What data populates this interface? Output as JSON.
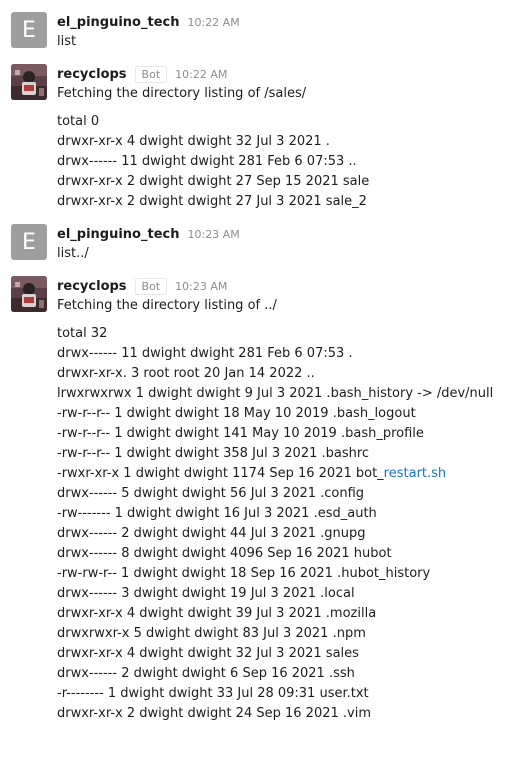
{
  "messages": [
    {
      "user": "el_pinguino_tech",
      "avatar_letter": "E",
      "time": "10:22 AM",
      "text": "list"
    },
    {
      "user": "recyclops",
      "bot_badge": "Bot",
      "time": "10:22 AM",
      "intro": "Fetching the directory listing of /sales/",
      "lines": [
        "total 0",
        "drwxr-xr-x 4 dwight dwight 32 Jul 3 2021 .",
        "drwx------ 11 dwight dwight 281 Feb 6 07:53 ..",
        "drwxr-xr-x 2 dwight dwight 27 Sep 15 2021 sale",
        "drwxr-xr-x 2 dwight dwight 27 Jul 3 2021 sale_2"
      ]
    },
    {
      "user": "el_pinguino_tech",
      "avatar_letter": "E",
      "time": "10:23 AM",
      "text": "list../"
    },
    {
      "user": "recyclops",
      "bot_badge": "Bot",
      "time": "10:23 AM",
      "intro": "Fetching the directory listing of ../",
      "lines": [
        "total 32",
        "drwx------ 11 dwight dwight 281 Feb 6 07:53 .",
        "drwxr-xr-x. 3 root root 20 Jan 14 2022 ..",
        "lrwxrwxrwx 1 dwight dwight 9 Jul 3 2021 .bash_history -> /dev/null",
        "-rw-r--r-- 1 dwight dwight 18 May 10 2019 .bash_logout",
        "-rw-r--r-- 1 dwight dwight 141 May 10 2019 .bash_profile",
        "-rw-r--r-- 1 dwight dwight 358 Jul 3 2021 .bashrc",
        "-rwxr-xr-x 1 dwight dwight 1174 Sep 16 2021 bot_",
        "drwx------ 5 dwight dwight 56 Jul 3 2021 .config",
        "-rw------- 1 dwight dwight 16 Jul 3 2021 .esd_auth",
        "drwx------ 2 dwight dwight 44 Jul 3 2021 .gnupg",
        "drwx------ 8 dwight dwight 4096 Sep 16 2021 hubot",
        "-rw-rw-r-- 1 dwight dwight 18 Sep 16 2021 .hubot_history",
        "drwx------ 3 dwight dwight 19 Jul 3 2021 .local",
        "drwxr-xr-x 4 dwight dwight 39 Jul 3 2021 .mozilla",
        "drwxrwxr-x 5 dwight dwight 83 Jul 3 2021 .npm",
        "drwxr-xr-x 4 dwight dwight 32 Jul 3 2021 sales",
        "drwx------ 2 dwight dwight 6 Sep 16 2021 .ssh",
        "-r-------- 1 dwight dwight 33 Jul 28 09:31 user.txt",
        "drwxr-xr-x 2 dwight dwight 24 Sep 16 2021 .vim"
      ],
      "link_text": "restart.sh"
    }
  ],
  "colors": {
    "link": "#1a73c5",
    "avatar_letter_bg": "#9e9e9e",
    "muted_text": "#8d8d8d"
  },
  "icons": {
    "user_avatar": "letter-avatar",
    "bot_avatar": "recyclops-avatar-icon"
  }
}
